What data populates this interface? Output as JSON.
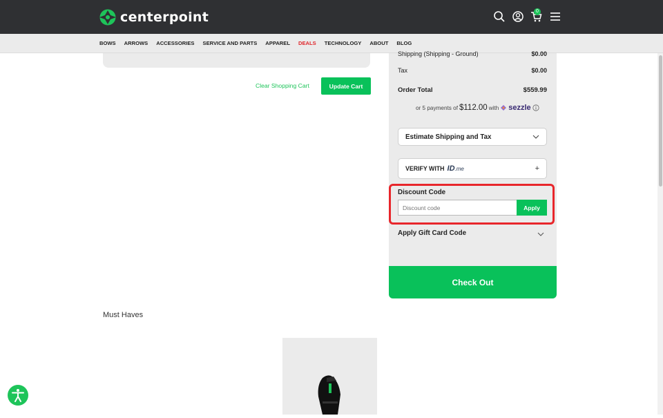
{
  "header": {
    "logo_text": "centerpoint",
    "cart_count": "0"
  },
  "nav": {
    "items": [
      "BOWS",
      "ARROWS",
      "ACCESSORIES",
      "SERVICE AND PARTS",
      "APPAREL",
      "DEALS",
      "TECHNOLOGY",
      "ABOUT",
      "BLOG"
    ],
    "highlight_color": "#e0262b"
  },
  "cart": {
    "clear_label": "Clear Shopping Cart",
    "update_label": "Update Cart"
  },
  "summary": {
    "shipping_label": "Shipping (Shipping - Ground)",
    "shipping_value": "$0.00",
    "tax_label": "Tax",
    "tax_value": "$0.00",
    "total_label": "Order Total",
    "total_value": "$559.99",
    "sezzle_prefix": "or 5 payments of",
    "sezzle_amount": "$112.00",
    "sezzle_with": "with",
    "sezzle_brand": "sezzle",
    "estimate_label": "Estimate Shipping and Tax",
    "verify_label": "VERIFY WITH",
    "idme_label": "ID",
    "idme_suffix": ".me",
    "plus": "+",
    "discount_label": "Discount Code",
    "discount_placeholder": "Discount code",
    "apply_label": "Apply",
    "gift_label": "Apply Gift Card Code",
    "checkout_label": "Check Out"
  },
  "recommendations": {
    "title": "Must Haves"
  },
  "colors": {
    "accent": "#09c15a",
    "header_bg": "#2f3033",
    "highlight_border": "#e8262b"
  }
}
